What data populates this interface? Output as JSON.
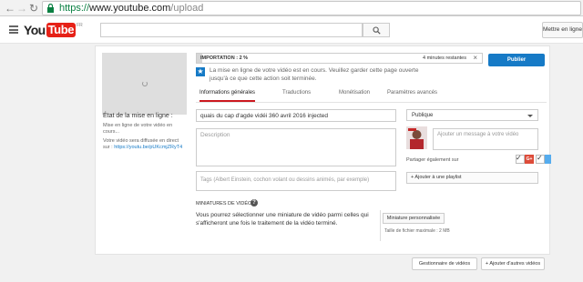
{
  "browser": {
    "url_scheme": "https://",
    "url_host": "www.youtube.com",
    "url_path": "/upload"
  },
  "header": {
    "logo_you": "You",
    "logo_tube": "Tube",
    "logo_country": "FR",
    "signin_label": "Mettre en ligne"
  },
  "status": {
    "title": "État de la mise en ligne :",
    "lines": [
      "Mise en ligne de votre vidéo en",
      "cours..."
    ],
    "direct_lines": [
      "Votre vidéo sera diffusée en direct",
      "sur : "
    ],
    "link": "https://youtu.be/pUKcmjZRyT4"
  },
  "upload": {
    "progress_label": "IMPORTATION : 2 %",
    "progress_percent": 2,
    "remaining": "4 minutes restantes",
    "close": "×",
    "publish_label": "Publier",
    "notice_lines": [
      "La mise en ligne de votre vidéo est en cours. Veuillez garder cette page ouverte",
      "jusqu'à ce que cette action soit terminée."
    ]
  },
  "tabs": [
    "Informations générales",
    "Traductions",
    "Monétisation",
    "Paramètres avancés"
  ],
  "form": {
    "title_value": "quais du cap d'agde vidéi 360 avril 2016  injected",
    "description_placeholder": "Description",
    "tags_placeholder": "Tags (Albert Einstein, cochon volant ou dessins animés, par exemple)",
    "privacy_value": "Publique",
    "message_placeholder": "Ajouter un message à votre vidéo",
    "share_label": "Partager également sur",
    "google_label": "G+",
    "playlist_label": "+ Ajouter à une playlist"
  },
  "thumbnails": {
    "title": "MINIATURES DE VIDÉO",
    "help": "?",
    "text_lines": [
      "Vous pourrez sélectionner une miniature de vidéo parmi celles qui",
      "s'afficheront une fois le traitement de la vidéo terminé."
    ],
    "custom_label": "Miniature personnalisée",
    "max_size": "Taille de fichier maximale : 2 MB"
  },
  "footer": {
    "manager_label": "Gestionnaire de vidéos",
    "add_more_label": "+ Ajouter d'autres vidéos"
  },
  "colors": {
    "accent_blue": "#167ac6",
    "youtube_red": "#e62117",
    "google_red": "#dd4b39",
    "twitter_blue": "#55acee"
  }
}
